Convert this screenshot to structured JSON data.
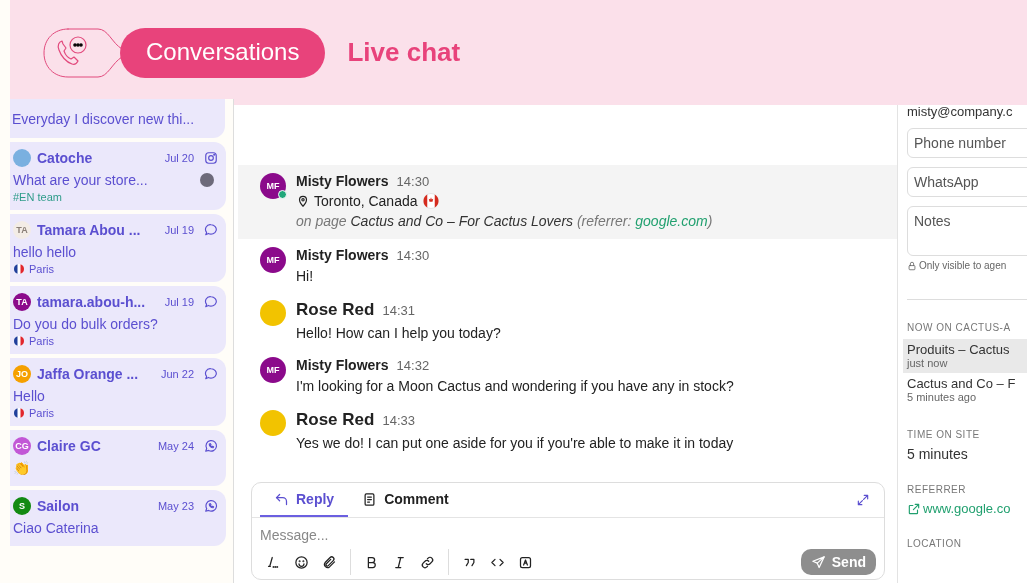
{
  "header": {
    "section": "Conversations",
    "title": "Live chat"
  },
  "conversations": [
    {
      "kind": "partial",
      "preview": "Everyday I discover new thi..."
    },
    {
      "kind": "instagram",
      "name": "Catoche",
      "date": "Jul 20",
      "avatar": {
        "kind": "photo"
      },
      "preview": "What are your store...",
      "tag": "#EN team",
      "assignee_photo": true
    },
    {
      "kind": "chat",
      "name": "Tamara Abou ...",
      "date": "Jul 19",
      "avatar": {
        "kind": "initials",
        "initials": "TA",
        "color": "#f3ece6"
      },
      "preview": "hello hello",
      "location": "Paris"
    },
    {
      "kind": "chat",
      "name": "tamara.abou-h...",
      "date": "Jul 19",
      "avatar": {
        "kind": "initials",
        "initials": "TA",
        "color": "#8b0a8b"
      },
      "preview": "Do you do bulk orders?",
      "location": "Paris"
    },
    {
      "kind": "chat",
      "name": "Jaffa Orange ...",
      "date": "Jun 22",
      "avatar": {
        "kind": "initials",
        "initials": "JO",
        "color": "#f5a000"
      },
      "preview": "Hello",
      "location": "Paris"
    },
    {
      "kind": "whatsapp",
      "name": "Claire GC",
      "date": "May 24",
      "avatar": {
        "kind": "initials",
        "initials": "CG",
        "color": "#c257d6"
      },
      "preview": "👏"
    },
    {
      "kind": "whatsapp",
      "name": "Sailon",
      "date": "May 23",
      "avatar": {
        "kind": "initials",
        "initials": "S",
        "color": "#138a13"
      },
      "preview": "Ciao Caterina"
    }
  ],
  "messages": [
    {
      "kind": "visitor",
      "sender": "Misty Flowers",
      "time": "14:30",
      "online": true,
      "avatar": {
        "kind": "initials",
        "initials": "MF",
        "color": "#8b0a8b"
      },
      "location": "Toronto, Canada",
      "page_intro": "on page",
      "page_title": "Cactus and Co – For Cactus Lovers",
      "referrer_intro": "(referrer:",
      "referrer_link": "google.com",
      "referrer_close": ")"
    },
    {
      "kind": "customer",
      "sender": "Misty Flowers",
      "time": "14:30",
      "online": false,
      "avatar": {
        "kind": "initials",
        "initials": "MF",
        "color": "#8b0a8b"
      },
      "text": "Hi!"
    },
    {
      "kind": "agent",
      "sender": "Rose Red",
      "time": "14:31",
      "online": false,
      "avatar": {
        "kind": "photo"
      },
      "text": "Hello! How can I help you today?"
    },
    {
      "kind": "customer",
      "sender": "Misty Flowers",
      "time": "14:32",
      "online": false,
      "avatar": {
        "kind": "initials",
        "initials": "MF",
        "color": "#8b0a8b"
      },
      "text": "I'm looking for a Moon Cactus and wondering if you have any in stock?"
    },
    {
      "kind": "agent",
      "sender": "Rose Red",
      "time": "14:33",
      "online": false,
      "avatar": {
        "kind": "photo"
      },
      "text": "Yes we do! I can put one aside for you if you're able to make it in today"
    }
  ],
  "composer": {
    "tabs": [
      {
        "label": "Reply",
        "selected": true
      },
      {
        "label": "Comment",
        "selected": false
      }
    ],
    "placeholder": "Message...",
    "send": {
      "label": "Send",
      "disabled": true
    }
  },
  "details": {
    "email": "misty@company.c",
    "fields": [
      {
        "placeholder": "Phone number"
      },
      {
        "placeholder": "WhatsApp"
      }
    ],
    "notes": {
      "placeholder": "Notes"
    },
    "notes_hint": "Only visible to agen",
    "now_on": {
      "heading": "NOW ON CACTUS-A",
      "pages": [
        {
          "title": "Produits – Cactus",
          "time": "just now",
          "selected": true
        },
        {
          "title": "Cactus and Co – F",
          "time": "5 minutes ago",
          "selected": false
        }
      ]
    },
    "time_on_site": {
      "heading": "TIME ON SITE",
      "value": "5 minutes"
    },
    "referrer": {
      "heading": "REFERRER",
      "link": "www.google.co"
    },
    "location": {
      "heading": "LOCATION"
    }
  }
}
